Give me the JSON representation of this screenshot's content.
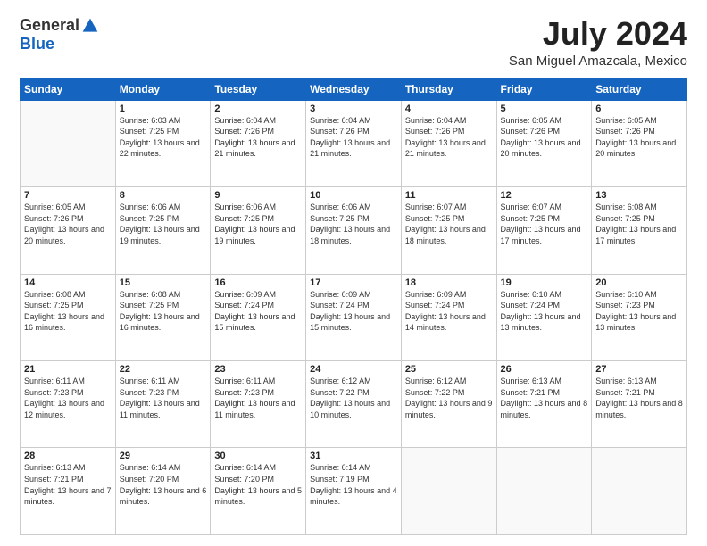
{
  "header": {
    "logo_general": "General",
    "logo_blue": "Blue",
    "title": "July 2024",
    "location": "San Miguel Amazcala, Mexico"
  },
  "weekdays": [
    "Sunday",
    "Monday",
    "Tuesday",
    "Wednesday",
    "Thursday",
    "Friday",
    "Saturday"
  ],
  "days": [
    {
      "date": "",
      "sunrise": "",
      "sunset": "",
      "daylight": ""
    },
    {
      "date": "1",
      "sunrise": "6:03 AM",
      "sunset": "7:25 PM",
      "daylight": "13 hours and 22 minutes."
    },
    {
      "date": "2",
      "sunrise": "6:04 AM",
      "sunset": "7:26 PM",
      "daylight": "13 hours and 21 minutes."
    },
    {
      "date": "3",
      "sunrise": "6:04 AM",
      "sunset": "7:26 PM",
      "daylight": "13 hours and 21 minutes."
    },
    {
      "date": "4",
      "sunrise": "6:04 AM",
      "sunset": "7:26 PM",
      "daylight": "13 hours and 21 minutes."
    },
    {
      "date": "5",
      "sunrise": "6:05 AM",
      "sunset": "7:26 PM",
      "daylight": "13 hours and 20 minutes."
    },
    {
      "date": "6",
      "sunrise": "6:05 AM",
      "sunset": "7:26 PM",
      "daylight": "13 hours and 20 minutes."
    },
    {
      "date": "7",
      "sunrise": "6:05 AM",
      "sunset": "7:26 PM",
      "daylight": "13 hours and 20 minutes."
    },
    {
      "date": "8",
      "sunrise": "6:06 AM",
      "sunset": "7:25 PM",
      "daylight": "13 hours and 19 minutes."
    },
    {
      "date": "9",
      "sunrise": "6:06 AM",
      "sunset": "7:25 PM",
      "daylight": "13 hours and 19 minutes."
    },
    {
      "date": "10",
      "sunrise": "6:06 AM",
      "sunset": "7:25 PM",
      "daylight": "13 hours and 18 minutes."
    },
    {
      "date": "11",
      "sunrise": "6:07 AM",
      "sunset": "7:25 PM",
      "daylight": "13 hours and 18 minutes."
    },
    {
      "date": "12",
      "sunrise": "6:07 AM",
      "sunset": "7:25 PM",
      "daylight": "13 hours and 17 minutes."
    },
    {
      "date": "13",
      "sunrise": "6:08 AM",
      "sunset": "7:25 PM",
      "daylight": "13 hours and 17 minutes."
    },
    {
      "date": "14",
      "sunrise": "6:08 AM",
      "sunset": "7:25 PM",
      "daylight": "13 hours and 16 minutes."
    },
    {
      "date": "15",
      "sunrise": "6:08 AM",
      "sunset": "7:25 PM",
      "daylight": "13 hours and 16 minutes."
    },
    {
      "date": "16",
      "sunrise": "6:09 AM",
      "sunset": "7:24 PM",
      "daylight": "13 hours and 15 minutes."
    },
    {
      "date": "17",
      "sunrise": "6:09 AM",
      "sunset": "7:24 PM",
      "daylight": "13 hours and 15 minutes."
    },
    {
      "date": "18",
      "sunrise": "6:09 AM",
      "sunset": "7:24 PM",
      "daylight": "13 hours and 14 minutes."
    },
    {
      "date": "19",
      "sunrise": "6:10 AM",
      "sunset": "7:24 PM",
      "daylight": "13 hours and 13 minutes."
    },
    {
      "date": "20",
      "sunrise": "6:10 AM",
      "sunset": "7:23 PM",
      "daylight": "13 hours and 13 minutes."
    },
    {
      "date": "21",
      "sunrise": "6:11 AM",
      "sunset": "7:23 PM",
      "daylight": "13 hours and 12 minutes."
    },
    {
      "date": "22",
      "sunrise": "6:11 AM",
      "sunset": "7:23 PM",
      "daylight": "13 hours and 11 minutes."
    },
    {
      "date": "23",
      "sunrise": "6:11 AM",
      "sunset": "7:23 PM",
      "daylight": "13 hours and 11 minutes."
    },
    {
      "date": "24",
      "sunrise": "6:12 AM",
      "sunset": "7:22 PM",
      "daylight": "13 hours and 10 minutes."
    },
    {
      "date": "25",
      "sunrise": "6:12 AM",
      "sunset": "7:22 PM",
      "daylight": "13 hours and 9 minutes."
    },
    {
      "date": "26",
      "sunrise": "6:13 AM",
      "sunset": "7:21 PM",
      "daylight": "13 hours and 8 minutes."
    },
    {
      "date": "27",
      "sunrise": "6:13 AM",
      "sunset": "7:21 PM",
      "daylight": "13 hours and 8 minutes."
    },
    {
      "date": "28",
      "sunrise": "6:13 AM",
      "sunset": "7:21 PM",
      "daylight": "13 hours and 7 minutes."
    },
    {
      "date": "29",
      "sunrise": "6:14 AM",
      "sunset": "7:20 PM",
      "daylight": "13 hours and 6 minutes."
    },
    {
      "date": "30",
      "sunrise": "6:14 AM",
      "sunset": "7:20 PM",
      "daylight": "13 hours and 5 minutes."
    },
    {
      "date": "31",
      "sunrise": "6:14 AM",
      "sunset": "7:19 PM",
      "daylight": "13 hours and 4 minutes."
    },
    {
      "date": "",
      "sunrise": "",
      "sunset": "",
      "daylight": ""
    },
    {
      "date": "",
      "sunrise": "",
      "sunset": "",
      "daylight": ""
    },
    {
      "date": "",
      "sunrise": "",
      "sunset": "",
      "daylight": ""
    },
    {
      "date": "",
      "sunrise": "",
      "sunset": "",
      "daylight": ""
    }
  ]
}
